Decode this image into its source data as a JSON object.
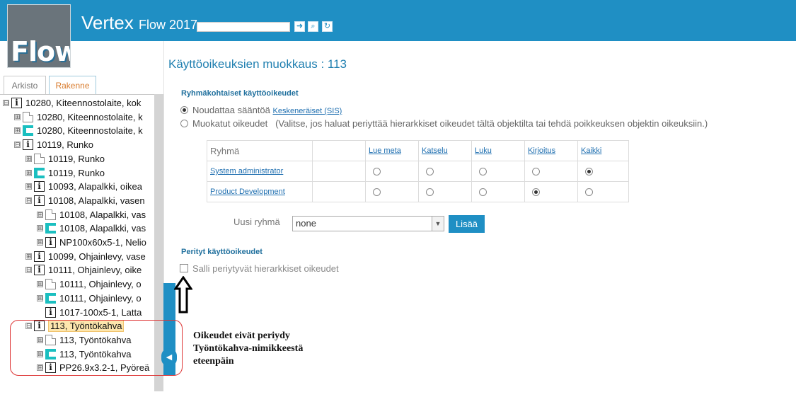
{
  "header": {
    "logo_text": "Flow",
    "app_title_bold": "Vertex",
    "app_title_rest": "Flow 2017",
    "buttons": [
      {
        "name": "go-icon",
        "glyph": "➜"
      },
      {
        "name": "search-icon",
        "glyph": "⌕"
      },
      {
        "name": "refresh-icon",
        "glyph": "↻"
      }
    ]
  },
  "tabs": [
    {
      "label": "Arkisto",
      "active": false
    },
    {
      "label": "Rakenne",
      "active": true
    }
  ],
  "tree": [
    {
      "toggle": "⊟",
      "icon": "i",
      "label": "10280, Kiteennostolaite, kok"
    },
    {
      "toggle": "⊞",
      "icon": "doc",
      "label": "10280, Kiteennostolaite, k"
    },
    {
      "toggle": "⊞",
      "icon": "c",
      "label": "10280, Kiteennostolaite, k"
    },
    {
      "toggle": "⊟",
      "icon": "i",
      "label": "10119, Runko"
    },
    {
      "toggle": "⊞",
      "icon": "doc",
      "label": "10119, Runko"
    },
    {
      "toggle": "⊞",
      "icon": "c",
      "label": "10119, Runko"
    },
    {
      "toggle": "⊞",
      "icon": "i",
      "label": "10093, Alapalkki, oikea"
    },
    {
      "toggle": "⊟",
      "icon": "i",
      "label": "10108, Alapalkki, vasen"
    },
    {
      "toggle": "⊞",
      "icon": "doc",
      "label": "10108, Alapalkki, vas"
    },
    {
      "toggle": "⊞",
      "icon": "c",
      "label": "10108, Alapalkki, vas"
    },
    {
      "toggle": "⊞",
      "icon": "i",
      "label": "NP100x60x5-1, Nelio"
    },
    {
      "toggle": "⊞",
      "icon": "i",
      "label": "10099, Ohjainlevy, vase"
    },
    {
      "toggle": "⊟",
      "icon": "i",
      "label": "10111, Ohjainlevy, oike"
    },
    {
      "toggle": "⊞",
      "icon": "doc",
      "label": "10111, Ohjainlevy, o"
    },
    {
      "toggle": "⊞",
      "icon": "c",
      "label": "10111, Ohjainlevy, o"
    },
    {
      "toggle": "",
      "icon": "i",
      "label": "1017-100x5-1, Latta"
    },
    {
      "toggle": "⊟",
      "icon": "i",
      "label": "113, Työntökahva",
      "selected": true
    },
    {
      "toggle": "⊞",
      "icon": "doc",
      "label": "113, Työntökahva"
    },
    {
      "toggle": "⊞",
      "icon": "c",
      "label": "113, Työntökahva"
    },
    {
      "toggle": "⊞",
      "icon": "i",
      "label": "PP26.9x3.2-1, Pyöreä"
    }
  ],
  "main": {
    "title": "Käyttöoikeuksien muokkaus : 113",
    "group_section_title": "Ryhmäkohtaiset käyttöoikeudet",
    "option_inherit": "Noudattaa sääntöä",
    "option_inherit_link": "Keskeneräiset (SIS)",
    "option_custom": "Muokatut oikeudet",
    "option_custom_hint": "(Valitse, jos haluat periyttää hierarkkiset oikeudet tältä objektilta tai tehdä poikkeuksen objektin oikeuksiin.)",
    "table": {
      "group_header": "Ryhmä",
      "columns": [
        "Lue meta",
        "Katselu",
        "Luku",
        "Kirjoitus",
        "Kaikki"
      ],
      "rows": [
        {
          "group": "System administrator",
          "selected": 4
        },
        {
          "group": "Product Development",
          "selected": 3
        }
      ]
    },
    "new_group_label": "Uusi ryhmä",
    "new_group_value": "none",
    "add_button": "Lisää",
    "inherited_section_title": "Perityt käyttöoikeudet",
    "allow_inherited_label": "Salli periytyvät hierarkkiset oikeudet",
    "allow_inherited_checked": false
  },
  "annotation": {
    "line1": "Oikeudet eivät periydy",
    "line2": "Työntökahva-nimikkeestä",
    "line3": "eteenpäin"
  }
}
